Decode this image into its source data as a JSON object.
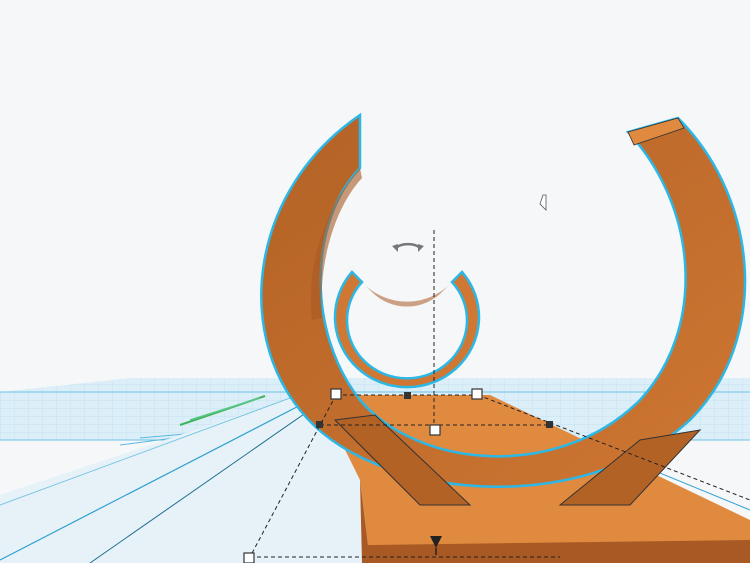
{
  "viewport": {
    "label": "",
    "colors": {
      "background": "#f5f7f8",
      "workplane_fill": "#dceef7",
      "workplane_grid": "#9fd3ea",
      "shape_body": "#cf7733",
      "shape_side": "#a95a24",
      "shape_top": "#e08a40",
      "selection_outline": "#2cb8e6",
      "handle_fill": "#ffffff",
      "handle_stroke": "#333333"
    },
    "icons": {
      "rotate_handle": "rotate-arc-icon",
      "lift_handle": "cone-arrow-icon",
      "cursor": "mouse-cursor-icon"
    }
  }
}
